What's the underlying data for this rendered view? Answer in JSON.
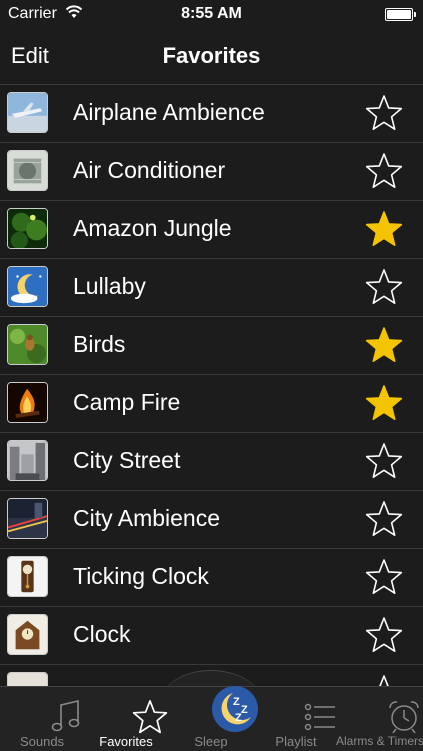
{
  "status": {
    "carrier": "Carrier",
    "time": "8:55 AM"
  },
  "nav": {
    "edit_label": "Edit",
    "title": "Favorites"
  },
  "items": [
    {
      "label": "Airplane Ambience",
      "favorite": false,
      "icon": "airplane-thumb"
    },
    {
      "label": "Air Conditioner",
      "favorite": false,
      "icon": "air-conditioner-thumb"
    },
    {
      "label": "Amazon Jungle",
      "favorite": true,
      "icon": "jungle-thumb"
    },
    {
      "label": "Lullaby",
      "favorite": false,
      "icon": "lullaby-thumb"
    },
    {
      "label": "Birds",
      "favorite": true,
      "icon": "birds-thumb"
    },
    {
      "label": "Camp Fire",
      "favorite": true,
      "icon": "campfire-thumb"
    },
    {
      "label": "City Street",
      "favorite": false,
      "icon": "city-street-thumb"
    },
    {
      "label": "City Ambience",
      "favorite": false,
      "icon": "city-ambience-thumb"
    },
    {
      "label": "Ticking Clock",
      "favorite": false,
      "icon": "ticking-clock-thumb"
    },
    {
      "label": "Clock",
      "favorite": false,
      "icon": "clock-thumb"
    },
    {
      "label": "",
      "favorite": false,
      "icon": "partial-thumb"
    }
  ],
  "tabs": [
    {
      "label": "Sounds",
      "icon": "music-note-icon"
    },
    {
      "label": "Favorites",
      "icon": "star-icon",
      "active": true
    },
    {
      "label": "Sleep",
      "icon": "moon-zzz-icon"
    },
    {
      "label": "Playlist",
      "icon": "list-icon"
    },
    {
      "label": "Alarms & Timers",
      "icon": "alarm-clock-icon"
    }
  ],
  "colors": {
    "star_filled": "#f5c400",
    "background": "#1c1c1c",
    "tab_bg": "#232323"
  }
}
